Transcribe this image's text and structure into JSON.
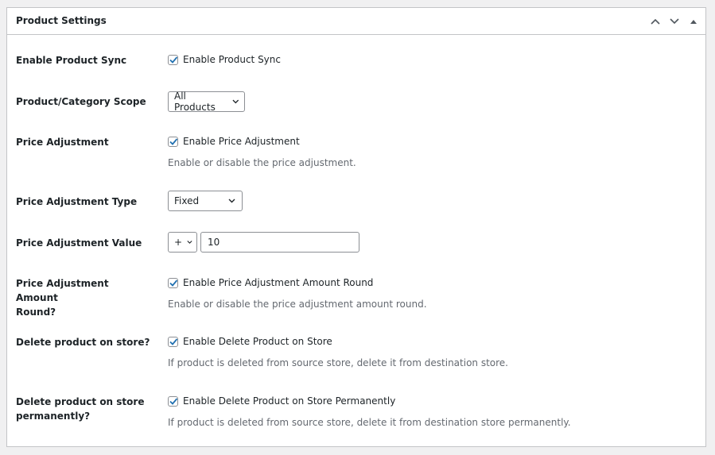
{
  "panel": {
    "title": "Product Settings",
    "controls": [
      "chevron-up",
      "chevron-down",
      "triangle-up"
    ]
  },
  "settings": [
    {
      "label": "Enable Product Sync",
      "checkbox_label": "Enable Product Sync",
      "checked": true
    },
    {
      "label": "Product/Category Scope",
      "select_value": "All Products"
    },
    {
      "label": "Price Adjustment",
      "checkbox_label": "Enable Price Adjustment",
      "checked": true,
      "description": "Enable or disable the price adjustment."
    },
    {
      "label": "Price Adjustment Type",
      "select_value": "Fixed"
    },
    {
      "label": "Price Adjustment Value",
      "operator_value": "+",
      "input_value": "10"
    },
    {
      "label_line1": "Price Adjustment Amount",
      "label_line2": "Round?",
      "checkbox_label": "Enable Price Adjustment Amount Round",
      "checked": true,
      "description": "Enable or disable the price adjustment amount round."
    },
    {
      "label": "Delete product on store?",
      "checkbox_label": "Enable Delete Product on Store",
      "checked": true,
      "description": "If product is deleted from source store, delete it from destination store."
    },
    {
      "label_line1": "Delete product on store",
      "label_line2": "permanently?",
      "checkbox_label": "Enable Delete Product on Store Permanently",
      "checked": true,
      "description": "If product is deleted from source store, delete it from destination store permanently."
    }
  ],
  "colors": {
    "accent": "#2271b1",
    "border": "#c3c4c7",
    "muted_text": "#646970"
  }
}
